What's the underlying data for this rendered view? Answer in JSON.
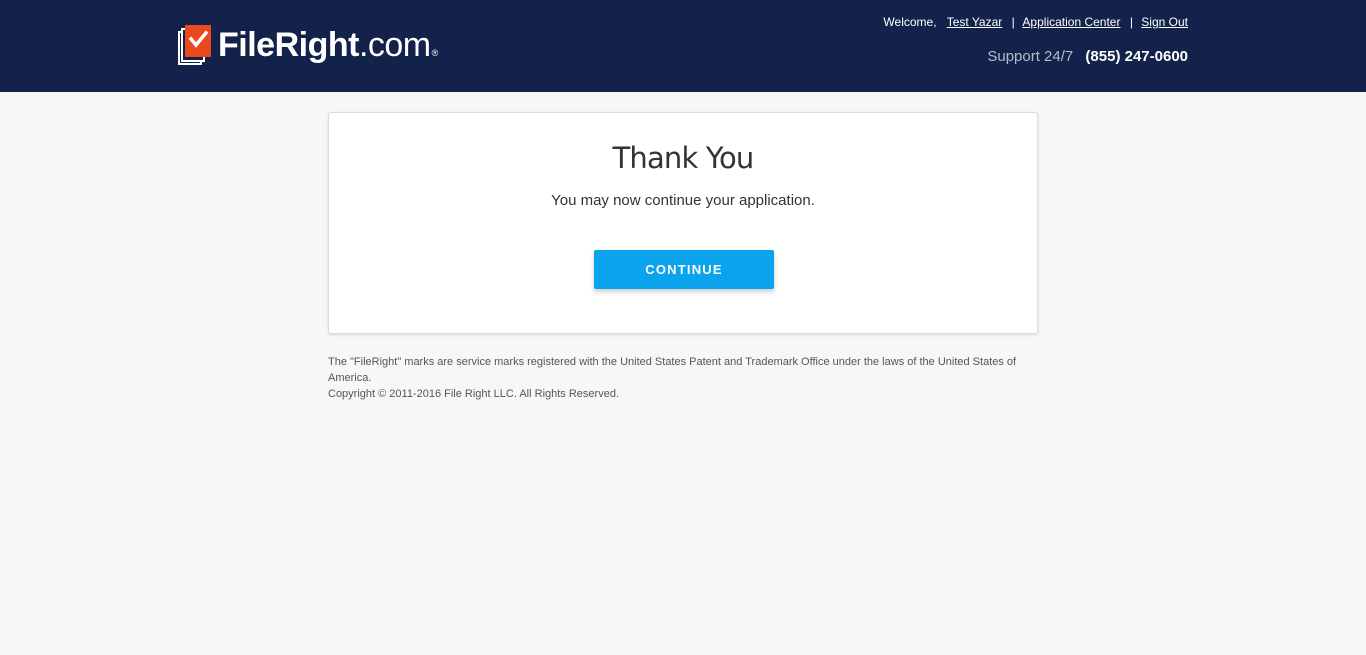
{
  "header": {
    "logo": {
      "text_bold": "FileRight",
      "text_regular": ".com",
      "registered": "®",
      "colors": {
        "check_box": "#e8491d",
        "pages": "#ffffff"
      }
    },
    "welcome_label": "Welcome,",
    "user_name": "Test Yazar",
    "separator": "|",
    "application_center": "Application Center",
    "sign_out": "Sign Out",
    "support_label": "Support 24/7",
    "support_phone": "(855) 247-0600",
    "colors": {
      "background": "#13224a"
    }
  },
  "main": {
    "title": "Thank You",
    "message": "You may now continue your application.",
    "continue_button": "CONTINUE",
    "colors": {
      "button": "#0aa3ec"
    }
  },
  "footer": {
    "trademark": "The \"FileRight\" marks are service marks registered with the United States Patent and Trademark Office under the laws of the United States of America.",
    "copyright": "Copyright © 2011-2016 File Right LLC. All Rights Reserved."
  }
}
